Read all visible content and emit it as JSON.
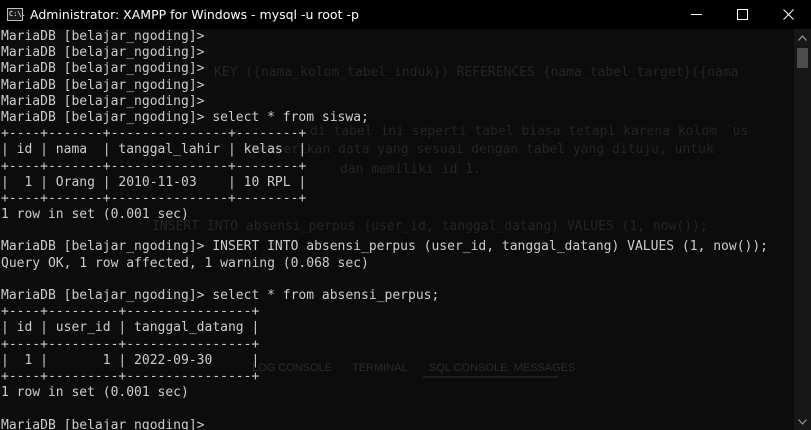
{
  "window": {
    "icon_text": "C:\\.",
    "title": "Administrator:  XAMPP for Windows - mysql  -u root -p"
  },
  "ghost_text": [
    "KEY ({nama_kolom_tabel_induk}) REFERENCES {nama_tabel_target}({nama",
    "di tabel ini seperti tabel biasa tetapi karena kolom `us",
    "memberikan data yang sesuai dengan tabel yang dituju, untuk",
    "dan memiliki id 1.",
    "INSERT INTO absensi_perpus (user_id, tanggal_datang) VALUES (1, now());"
  ],
  "ghost_tabs": [
    "LOG CONSOLE",
    "TERMINAL",
    "SQL CONSOLE: MESSAGES"
  ],
  "terminal_lines": [
    "MariaDB [belajar_ngoding]>",
    "MariaDB [belajar_ngoding]>",
    "MariaDB [belajar_ngoding]>",
    "MariaDB [belajar_ngoding]>",
    "MariaDB [belajar_ngoding]>",
    "MariaDB [belajar_ngoding]> select * from siswa;",
    "+----+-------+---------------+--------+",
    "| id | nama  | tanggal_lahir | kelas  |",
    "+----+-------+---------------+--------+",
    "|  1 | Orang | 2010-11-03    | 10 RPL |",
    "+----+-------+---------------+--------+",
    "1 row in set (0.001 sec)",
    "",
    "MariaDB [belajar_ngoding]> INSERT INTO absensi_perpus (user_id, tanggal_datang) VALUES (1, now());",
    "Query OK, 1 row affected, 1 warning (0.068 sec)",
    "",
    "MariaDB [belajar_ngoding]> select * from absensi_perpus;",
    "+----+---------+----------------+",
    "| id | user_id | tanggal_datang |",
    "+----+---------+----------------+",
    "|  1 |       1 | 2022-09-30     |",
    "+----+---------+----------------+",
    "1 row in set (0.001 sec)",
    "",
    "MariaDB [belajar_ngoding]>"
  ]
}
